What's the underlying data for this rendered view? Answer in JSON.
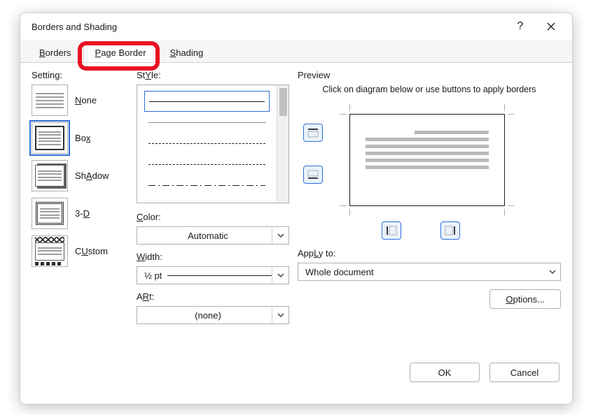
{
  "dialog": {
    "title": "Borders and Shading",
    "help_aria": "Help",
    "close_aria": "Close"
  },
  "tabs": {
    "borders": "Borders",
    "borders_u": "B",
    "page_border": "Page Border",
    "page_border_u": "P",
    "shading": "Shading",
    "shading_u": "S"
  },
  "setting": {
    "label": "Setting:",
    "none": "None",
    "none_u": "N",
    "box": "Box",
    "box_u": "x",
    "shadow": "Shadow",
    "shadow_u": "A",
    "threed": "3-D",
    "threed_u": "D",
    "custom": "Custom",
    "custom_u": "U"
  },
  "style": {
    "label": "Style:",
    "label_u": "Y",
    "color_label": "Color:",
    "color_label_u": "C",
    "color_value": "Automatic",
    "width_label": "Width:",
    "width_label_u": "W",
    "width_value": "½ pt",
    "art_label": "Art:",
    "art_label_u": "R",
    "art_value": "(none)"
  },
  "preview": {
    "label": "Preview",
    "msg": "Click on diagram below or use buttons to apply borders",
    "apply_label": "Apply to:",
    "apply_label_u": "L",
    "apply_value": "Whole document",
    "options": "Options...",
    "options_u": "O"
  },
  "footer": {
    "ok": "OK",
    "cancel": "Cancel"
  }
}
